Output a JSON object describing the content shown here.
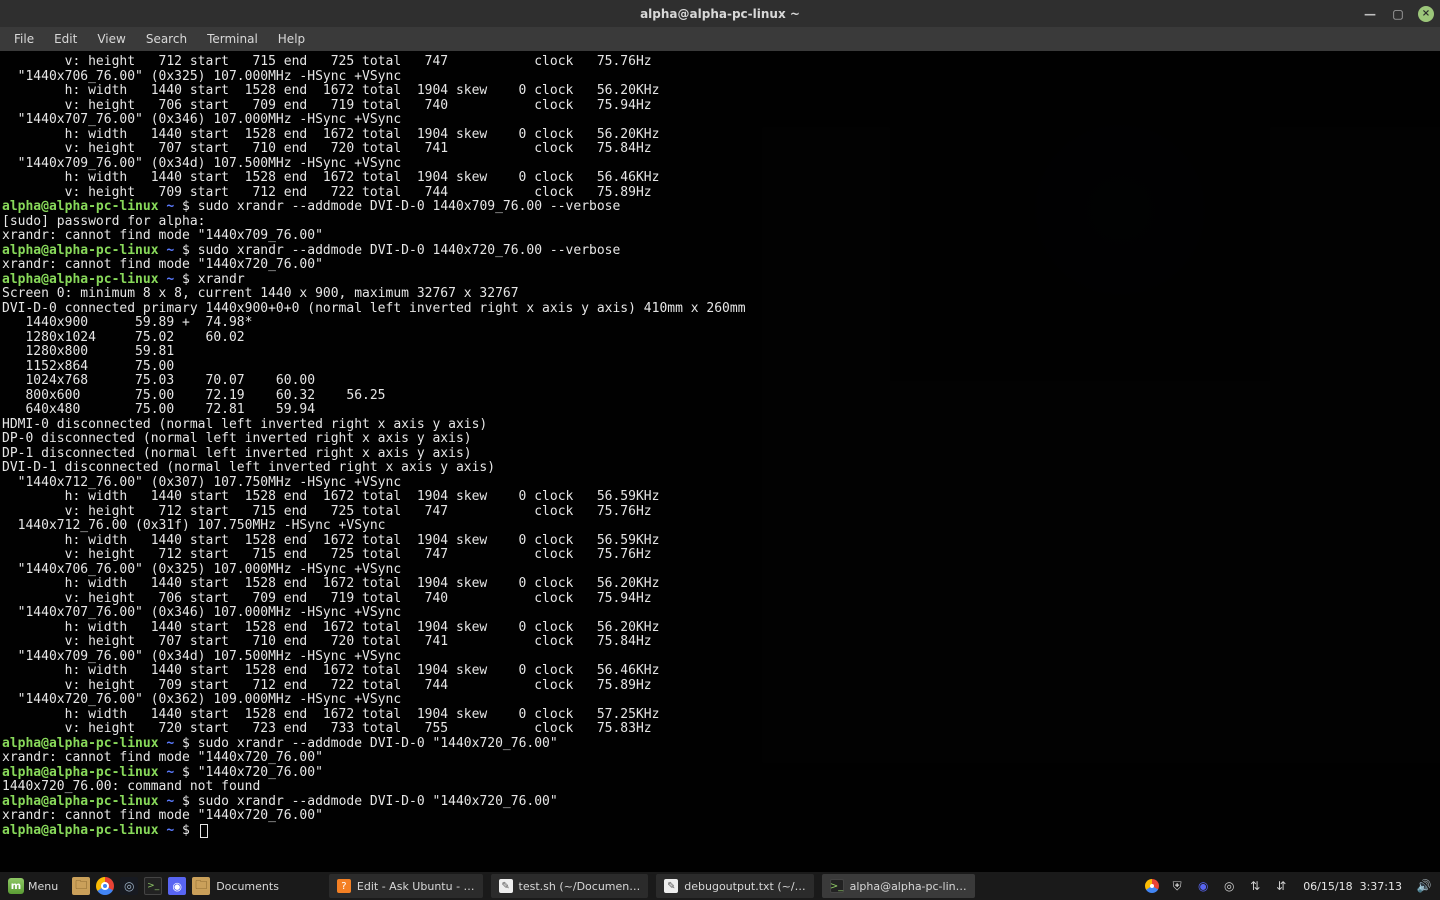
{
  "window": {
    "title": "alpha@alpha-pc-linux ~",
    "minimize_icon": "—",
    "maximize_icon": "▢",
    "close_icon": "×"
  },
  "menubar": [
    "File",
    "Edit",
    "View",
    "Search",
    "Terminal",
    "Help"
  ],
  "prompt": {
    "user_host": "alpha@alpha-pc-linux",
    "path": "~",
    "sep": "$"
  },
  "output_top": [
    "        v: height   712 start   715 end   725 total   747           clock   75.76Hz",
    "  \"1440x706_76.00\" (0x325) 107.000MHz -HSync +VSync",
    "        h: width   1440 start  1528 end  1672 total  1904 skew    0 clock   56.20KHz",
    "        v: height   706 start   709 end   719 total   740           clock   75.94Hz",
    "  \"1440x707_76.00\" (0x346) 107.000MHz -HSync +VSync",
    "        h: width   1440 start  1528 end  1672 total  1904 skew    0 clock   56.20KHz",
    "        v: height   707 start   710 end   720 total   741           clock   75.84Hz",
    "  \"1440x709_76.00\" (0x34d) 107.500MHz -HSync +VSync",
    "        h: width   1440 start  1528 end  1672 total  1904 skew    0 clock   56.46KHz",
    "        v: height   709 start   712 end   722 total   744           clock   75.89Hz"
  ],
  "cmds": {
    "c1": "sudo xrandr --addmode DVI-D-0 1440x709_76.00 --verbose",
    "out1a": "[sudo] password for alpha:",
    "out1b": "xrandr: cannot find mode \"1440x709_76.00\"",
    "c2": "sudo xrandr --addmode DVI-D-0 1440x720_76.00 --verbose",
    "out2": "xrandr: cannot find mode \"1440x720_76.00\"",
    "c3": "xrandr",
    "xrandr_out": [
      "Screen 0: minimum 8 x 8, current 1440 x 900, maximum 32767 x 32767",
      "DVI-D-0 connected primary 1440x900+0+0 (normal left inverted right x axis y axis) 410mm x 260mm",
      "   1440x900      59.89 +  74.98*",
      "   1280x1024     75.02    60.02",
      "   1280x800      59.81",
      "   1152x864      75.00",
      "   1024x768      75.03    70.07    60.00",
      "   800x600       75.00    72.19    60.32    56.25",
      "   640x480       75.00    72.81    59.94",
      "HDMI-0 disconnected (normal left inverted right x axis y axis)",
      "DP-0 disconnected (normal left inverted right x axis y axis)",
      "DP-1 disconnected (normal left inverted right x axis y axis)",
      "DVI-D-1 disconnected (normal left inverted right x axis y axis)",
      "  \"1440x712_76.00\" (0x307) 107.750MHz -HSync +VSync",
      "        h: width   1440 start  1528 end  1672 total  1904 skew    0 clock   56.59KHz",
      "        v: height   712 start   715 end   725 total   747           clock   75.76Hz",
      "  1440x712_76.00 (0x31f) 107.750MHz -HSync +VSync",
      "        h: width   1440 start  1528 end  1672 total  1904 skew    0 clock   56.59KHz",
      "        v: height   712 start   715 end   725 total   747           clock   75.76Hz",
      "  \"1440x706_76.00\" (0x325) 107.000MHz -HSync +VSync",
      "        h: width   1440 start  1528 end  1672 total  1904 skew    0 clock   56.20KHz",
      "        v: height   706 start   709 end   719 total   740           clock   75.94Hz",
      "  \"1440x707_76.00\" (0x346) 107.000MHz -HSync +VSync",
      "        h: width   1440 start  1528 end  1672 total  1904 skew    0 clock   56.20KHz",
      "        v: height   707 start   710 end   720 total   741           clock   75.84Hz",
      "  \"1440x709_76.00\" (0x34d) 107.500MHz -HSync +VSync",
      "        h: width   1440 start  1528 end  1672 total  1904 skew    0 clock   56.46KHz",
      "        v: height   709 start   712 end   722 total   744           clock   75.89Hz",
      "  \"1440x720_76.00\" (0x362) 109.000MHz -HSync +VSync",
      "        h: width   1440 start  1528 end  1672 total  1904 skew    0 clock   57.25KHz",
      "        v: height   720 start   723 end   733 total   755           clock   75.83Hz"
    ],
    "c4": "sudo xrandr --addmode DVI-D-0 \"1440x720_76.00\"",
    "out4": "xrandr: cannot find mode \"1440x720_76.00\"",
    "c5": "\"1440x720_76.00\"",
    "out5": "1440x720_76.00: command not found",
    "c6": "sudo xrandr --addmode DVI-D-0 \"1440x720_76.00\"",
    "out6": "xrandr: cannot find mode \"1440x720_76.00\""
  },
  "panel": {
    "menu_label": "Menu",
    "documents_label": "Documents",
    "tasks": [
      {
        "icon": "askubuntu",
        "label": "Edit - Ask Ubuntu - …"
      },
      {
        "icon": "gedit",
        "label": "test.sh (~/Documen…"
      },
      {
        "icon": "gedit",
        "label": "debugoutput.txt (~/…"
      },
      {
        "icon": "term",
        "label": "alpha@alpha-pc-lin…"
      }
    ],
    "active_task_index": 3
  },
  "tray": {
    "clock": "06/15/18  3:37:13"
  }
}
